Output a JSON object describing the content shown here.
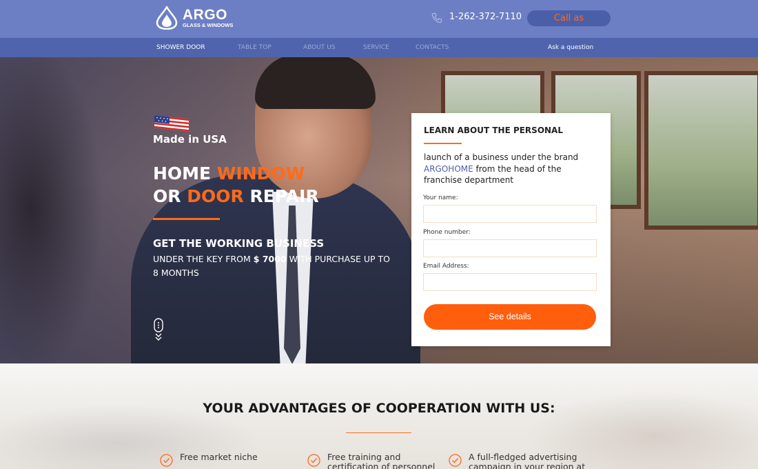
{
  "header": {
    "logo_name": "ARGO",
    "logo_sub": "GLASS & WINDOWS",
    "phone": "1-262-372-7110",
    "call_button": "Call as"
  },
  "nav": {
    "items": [
      "SHOWER DOOR",
      "TABLE TOP",
      "ABOUT US",
      "SERVICE",
      "CONTACTS"
    ],
    "active_index": 0,
    "ask": "Ask a question"
  },
  "hero": {
    "made_in": "Made in USA",
    "headline_line1_a": "HOME ",
    "headline_line1_b": "WINDOW",
    "headline_line2_a": "OR ",
    "headline_line2_b": "DOOR",
    "headline_line2_c": " REPAIR",
    "subhead": "GET THE WORKING BUSINESS",
    "subtext_a": "UNDER THE KEY FROM ",
    "subtext_b": "$ 7000",
    "subtext_c": " WITH PURCHASE UP TO 8 MONTHS"
  },
  "form": {
    "title": "LEARN ABOUT THE PERSONAL",
    "desc_a": "launch of a business under the brand ",
    "desc_brand": "ARGOHOME",
    "desc_b": " from the head of the franchise department",
    "name_label": "Your name:",
    "phone_label": "Phone number:",
    "email_label": "Email Address:",
    "submit": "See details"
  },
  "advantages": {
    "title": "YOUR ADVANTAGES OF COOPERATION WITH US:",
    "items": [
      "Free market niche",
      "Free training and certification of personnel",
      "A full-fledged advertising campaign in your region at our"
    ]
  },
  "colors": {
    "header_bg": "#6c7fc4",
    "nav_bg": "#4f64ad",
    "accent": "#ff6a1a",
    "brand_blue": "#4b5fa8"
  }
}
